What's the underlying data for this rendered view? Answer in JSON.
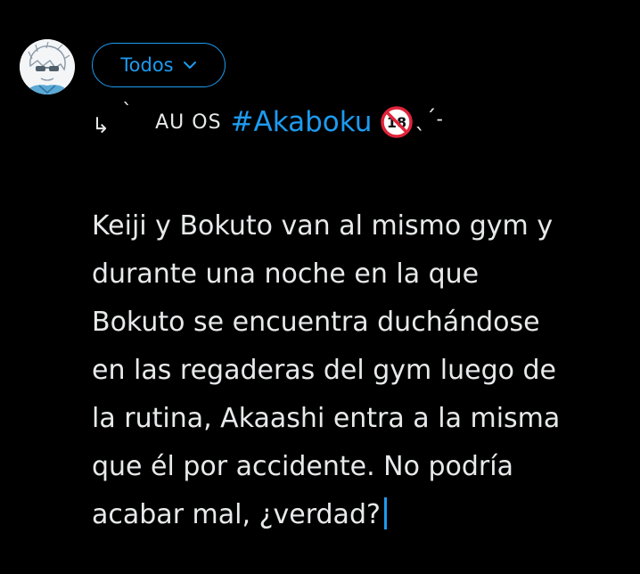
{
  "composer": {
    "avatar_icon": "anime-avatar-icon",
    "audience": {
      "label": "Todos",
      "icon": "chevron-down-icon",
      "accent": "#1d9bf0"
    },
    "title": {
      "arrow": "↳",
      "tick": "ˋ",
      "au_label": "AU OS",
      "hashtag": "#Akaboku",
      "no18_icon": "no-under-18-icon",
      "kaomoji": "ˎˊ˗"
    },
    "body": "Keiji y Bokuto van al mismo gym y\ndurante una noche en la que\nBokuto se encuentra duchándose\nen las regaderas del gym luego de\nla rutina, Akaashi entra a la misma\nque él por accidente. No podría\nacabar mal, ¿verdad?",
    "colors": {
      "background": "#000000",
      "text": "#e7e9ea",
      "link": "#1d9bf0"
    }
  }
}
